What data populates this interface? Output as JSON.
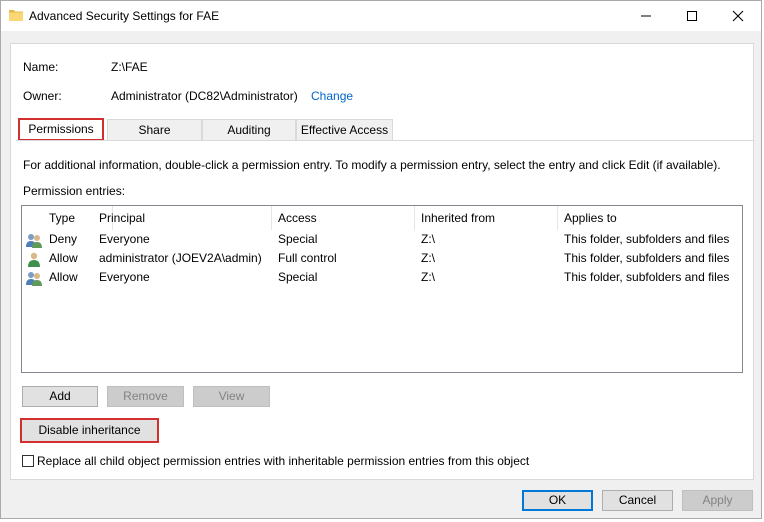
{
  "window": {
    "title": "Advanced Security Settings for FAE"
  },
  "info": {
    "name_label": "Name:",
    "name_value": "Z:\\FAE",
    "owner_label": "Owner:",
    "owner_value": "Administrator (DC82\\Administrator)",
    "change_link": "Change"
  },
  "tabs": [
    {
      "label": "Permissions",
      "active": true
    },
    {
      "label": "Share",
      "active": false
    },
    {
      "label": "Auditing",
      "active": false
    },
    {
      "label": "Effective Access",
      "active": false
    }
  ],
  "permissions": {
    "help_text": "For additional information, double-click a permission entry. To modify a permission entry, select the entry and click Edit (if available).",
    "entries_label": "Permission entries:",
    "columns": [
      "Type",
      "Principal",
      "Access",
      "Inherited from",
      "Applies to"
    ],
    "rows": [
      {
        "icon": "user-group-icon",
        "type": "Deny",
        "principal": "Everyone",
        "access": "Special",
        "inherited": "Z:\\",
        "applies": "This folder, subfolders and files"
      },
      {
        "icon": "user-icon",
        "type": "Allow",
        "principal": "administrator (JOEV2A\\admin)",
        "access": "Full control",
        "inherited": "Z:\\",
        "applies": "This folder, subfolders and files"
      },
      {
        "icon": "user-group-icon",
        "type": "Allow",
        "principal": "Everyone",
        "access": "Special",
        "inherited": "Z:\\",
        "applies": "This folder, subfolders and files"
      }
    ]
  },
  "buttons": {
    "add": "Add",
    "remove": "Remove",
    "view": "View",
    "disable_inheritance": "Disable inheritance",
    "ok": "OK",
    "cancel": "Cancel",
    "apply": "Apply"
  },
  "replace_checkbox": {
    "label": "Replace all child object permission entries with inheritable permission entries from this object",
    "checked": false
  },
  "colors": {
    "highlight": "#d32f2f",
    "link": "#0066cc",
    "default_button_border": "#0078d7"
  }
}
